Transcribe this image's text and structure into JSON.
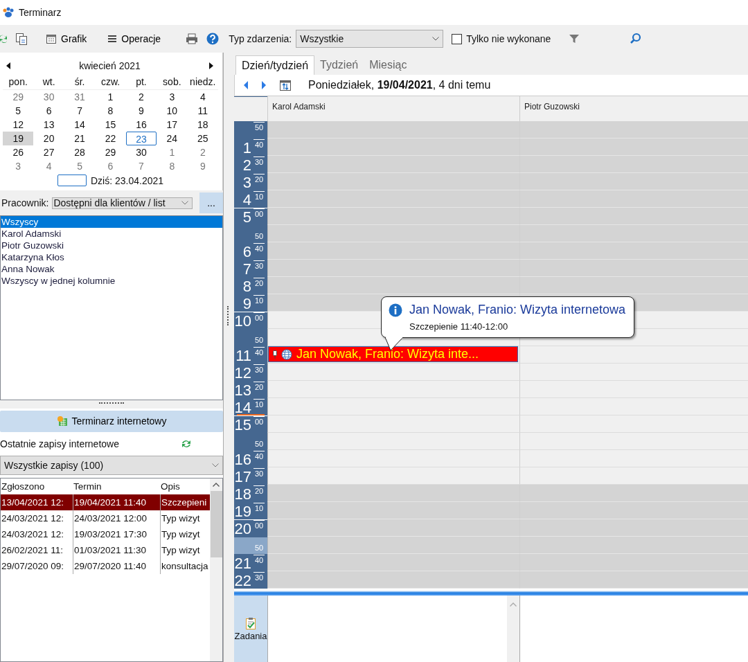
{
  "window": {
    "title": "Terminarz"
  },
  "toolbar": {
    "grafik": "Grafik",
    "operacje": "Operacje",
    "event_type_label": "Typ zdarzenia:",
    "event_type_value": "Wszystkie",
    "only_undone": {
      "label": "Tylko nie wykonane",
      "checked": false
    }
  },
  "mini_calendar": {
    "month": "kwiecień 2021",
    "weekdays": [
      "pon.",
      "wt.",
      "śr.",
      "czw.",
      "pt.",
      "sob.",
      "niedz."
    ],
    "weeks": [
      [
        {
          "day": "29",
          "other_month": true,
          "selected": false,
          "today": false
        },
        {
          "day": "30",
          "other_month": true,
          "selected": false,
          "today": false
        },
        {
          "day": "31",
          "other_month": true,
          "selected": false,
          "today": false
        },
        {
          "day": "1",
          "other_month": false,
          "selected": false,
          "today": false
        },
        {
          "day": "2",
          "other_month": false,
          "selected": false,
          "today": false
        },
        {
          "day": "3",
          "other_month": false,
          "selected": false,
          "today": false
        },
        {
          "day": "4",
          "other_month": false,
          "selected": false,
          "today": false
        }
      ],
      [
        {
          "day": "5",
          "other_month": false,
          "selected": false,
          "today": false
        },
        {
          "day": "6",
          "other_month": false,
          "selected": false,
          "today": false
        },
        {
          "day": "7",
          "other_month": false,
          "selected": false,
          "today": false
        },
        {
          "day": "8",
          "other_month": false,
          "selected": false,
          "today": false
        },
        {
          "day": "9",
          "other_month": false,
          "selected": false,
          "today": false
        },
        {
          "day": "10",
          "other_month": false,
          "selected": false,
          "today": false
        },
        {
          "day": "11",
          "other_month": false,
          "selected": false,
          "today": false
        }
      ],
      [
        {
          "day": "12",
          "other_month": false,
          "selected": false,
          "today": false
        },
        {
          "day": "13",
          "other_month": false,
          "selected": false,
          "today": false
        },
        {
          "day": "14",
          "other_month": false,
          "selected": false,
          "today": false
        },
        {
          "day": "15",
          "other_month": false,
          "selected": false,
          "today": false
        },
        {
          "day": "16",
          "other_month": false,
          "selected": false,
          "today": false
        },
        {
          "day": "17",
          "other_month": false,
          "selected": false,
          "today": false
        },
        {
          "day": "18",
          "other_month": false,
          "selected": false,
          "today": false
        }
      ],
      [
        {
          "day": "19",
          "other_month": false,
          "selected": true,
          "today": false
        },
        {
          "day": "20",
          "other_month": false,
          "selected": false,
          "today": false
        },
        {
          "day": "21",
          "other_month": false,
          "selected": false,
          "today": false
        },
        {
          "day": "22",
          "other_month": false,
          "selected": false,
          "today": false
        },
        {
          "day": "23",
          "other_month": false,
          "selected": false,
          "today": true
        },
        {
          "day": "24",
          "other_month": false,
          "selected": false,
          "today": false
        },
        {
          "day": "25",
          "other_month": false,
          "selected": false,
          "today": false
        }
      ],
      [
        {
          "day": "26",
          "other_month": false,
          "selected": false,
          "today": false
        },
        {
          "day": "27",
          "other_month": false,
          "selected": false,
          "today": false
        },
        {
          "day": "28",
          "other_month": false,
          "selected": false,
          "today": false
        },
        {
          "day": "29",
          "other_month": false,
          "selected": false,
          "today": false
        },
        {
          "day": "30",
          "other_month": false,
          "selected": false,
          "today": false
        },
        {
          "day": "1",
          "other_month": true,
          "selected": false,
          "today": false
        },
        {
          "day": "2",
          "other_month": true,
          "selected": false,
          "today": false
        }
      ],
      [
        {
          "day": "3",
          "other_month": true,
          "selected": false,
          "today": false
        },
        {
          "day": "4",
          "other_month": true,
          "selected": false,
          "today": false
        },
        {
          "day": "5",
          "other_month": true,
          "selected": false,
          "today": false
        },
        {
          "day": "6",
          "other_month": true,
          "selected": false,
          "today": false
        },
        {
          "day": "7",
          "other_month": true,
          "selected": false,
          "today": false
        },
        {
          "day": "8",
          "other_month": true,
          "selected": false,
          "today": false
        },
        {
          "day": "9",
          "other_month": true,
          "selected": false,
          "today": false
        }
      ]
    ],
    "today_label": "Dziś: 23.04.2021"
  },
  "employee_filter": {
    "label": "Pracownik:",
    "value": "Dostępni dla klientów / list",
    "more_button": "..."
  },
  "employees": [
    {
      "name": "Wszyscy",
      "selected": true
    },
    {
      "name": "Karol Adamski",
      "selected": false
    },
    {
      "name": "Piotr Guzowski",
      "selected": false
    },
    {
      "name": "Katarzyna Kłos",
      "selected": false
    },
    {
      "name": "Anna Nowak",
      "selected": false
    },
    {
      "name": "Wszyscy w jednej kolumnie",
      "selected": false
    }
  ],
  "online_panel": {
    "button": "Terminarz internetowy",
    "heading": "Ostatnie zapisy internetowe",
    "filter": "Wszystkie zapisy (100)",
    "columns": [
      "Zgłoszono",
      "Termin",
      "Opis"
    ],
    "rows": [
      {
        "cells": [
          "13/04/2021 12:",
          "19/04/2021 11:40",
          "Szczepieni"
        ],
        "selected": true
      },
      {
        "cells": [
          "24/03/2021 12:",
          "24/03/2021 12:00",
          "Typ wizyt"
        ],
        "selected": false
      },
      {
        "cells": [
          "24/03/2021 12:",
          "19/03/2021 17:30",
          "Typ wizyt"
        ],
        "selected": false
      },
      {
        "cells": [
          "26/02/2021 11:",
          "01/03/2021 11:30",
          "Typ wizyt"
        ],
        "selected": false
      },
      {
        "cells": [
          "29/07/2020 09:",
          "29/07/2020 11:40",
          "konsultacja"
        ],
        "selected": false
      }
    ]
  },
  "view_tabs": [
    {
      "label": "Dzień/tydzień",
      "selected": true
    },
    {
      "label": "Tydzień",
      "selected": false
    },
    {
      "label": "Miesiąc",
      "selected": false
    }
  ],
  "date_heading": "Poniedziałek, **19/04/2021**, 4 dni temu",
  "schedule": {
    "columns": [
      "Karol Adamski",
      "Piotr Guzowski"
    ],
    "rows": [
      {
        "hour": "",
        "minute": "50",
        "working": false,
        "selected": false,
        "now": false
      },
      {
        "hour": "1",
        "minute": "40",
        "working": false,
        "selected": false,
        "now": false
      },
      {
        "hour": "2",
        "minute": "30",
        "working": false,
        "selected": false,
        "now": false
      },
      {
        "hour": "3",
        "minute": "20",
        "working": false,
        "selected": false,
        "now": false
      },
      {
        "hour": "4",
        "minute": "10",
        "working": false,
        "selected": false,
        "now": false
      },
      {
        "hour": "5",
        "minute": "00",
        "working": false,
        "selected": false,
        "now": false
      },
      {
        "hour": "",
        "minute": "50",
        "working": false,
        "selected": false,
        "now": false
      },
      {
        "hour": "6",
        "minute": "40",
        "working": false,
        "selected": false,
        "now": false
      },
      {
        "hour": "7",
        "minute": "30",
        "working": false,
        "selected": false,
        "now": false
      },
      {
        "hour": "8",
        "minute": "20",
        "working": false,
        "selected": false,
        "now": false
      },
      {
        "hour": "9",
        "minute": "10",
        "working": false,
        "selected": false,
        "now": false
      },
      {
        "hour": "10",
        "minute": "00",
        "working": true,
        "selected": false,
        "now": false
      },
      {
        "hour": "",
        "minute": "50",
        "working": true,
        "selected": false,
        "now": false
      },
      {
        "hour": "11",
        "minute": "40",
        "working": true,
        "selected": false,
        "now": false,
        "appointment": {
          "title": "Jan Nowak, Franio: Wizyta inte...",
          "color": "#ff0000"
        }
      },
      {
        "hour": "12",
        "minute": "30",
        "working": true,
        "selected": false,
        "now": false
      },
      {
        "hour": "13",
        "minute": "20",
        "working": true,
        "selected": false,
        "now": false
      },
      {
        "hour": "14",
        "minute": "10",
        "working": true,
        "selected": false,
        "now": true
      },
      {
        "hour": "15",
        "minute": "00",
        "working": true,
        "selected": false,
        "now": false
      },
      {
        "hour": "",
        "minute": "50",
        "working": true,
        "selected": false,
        "now": false
      },
      {
        "hour": "16",
        "minute": "40",
        "working": true,
        "selected": false,
        "now": false
      },
      {
        "hour": "17",
        "minute": "30",
        "working": true,
        "selected": false,
        "now": false
      },
      {
        "hour": "18",
        "minute": "20",
        "working": false,
        "selected": false,
        "now": false
      },
      {
        "hour": "19",
        "minute": "10",
        "working": false,
        "selected": false,
        "now": false
      },
      {
        "hour": "20",
        "minute": "00",
        "working": false,
        "selected": false,
        "now": false
      },
      {
        "hour": "",
        "minute": "50",
        "working": false,
        "selected": true,
        "now": false
      },
      {
        "hour": "21",
        "minute": "40",
        "working": false,
        "selected": false,
        "now": false
      },
      {
        "hour": "22",
        "minute": "30",
        "working": false,
        "selected": false,
        "now": false
      }
    ],
    "tooltip": {
      "title": "Jan Nowak, Franio: Wizyta internetowa",
      "detail": "Szczepienie 11:40-12:00"
    }
  },
  "tasks": {
    "label": "Zadania"
  }
}
